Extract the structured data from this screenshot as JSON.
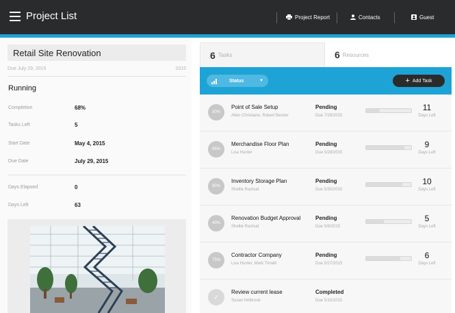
{
  "header": {
    "title": "Project List",
    "nav": [
      {
        "icon": "printer-icon",
        "label": "Project Report"
      },
      {
        "icon": "person-icon",
        "label": "Contacts"
      },
      {
        "icon": "user-icon",
        "label": "Guest"
      }
    ]
  },
  "project": {
    "title": "Retail Site Renovation",
    "due_text": "Due July 29, 2015",
    "year": "2015",
    "status": "Running",
    "stats": [
      {
        "label": "Completion",
        "value": "68%"
      },
      {
        "label": "Tasks Left",
        "value": "5"
      },
      {
        "label": "Start Date",
        "value": "May 4, 2015"
      },
      {
        "label": "Due Date",
        "value": "July 29, 2015"
      },
      {
        "label": "Days Elapsed",
        "value": "0"
      },
      {
        "label": "Days Left",
        "value": "63"
      }
    ]
  },
  "tabs": [
    {
      "count": "6",
      "label": "Tasks"
    },
    {
      "count": "6",
      "label": "Resources"
    }
  ],
  "toolbar": {
    "status_label": "Status",
    "add_task_label": "Add Task"
  },
  "colors": {
    "accent": "#1ea3d6",
    "header_bg": "#2a2b2d"
  },
  "tasks": [
    {
      "progress_label": "30%",
      "progress": 0.3,
      "name": "Point of Sale Setup",
      "people": "Allen Christiano, Robert Becker",
      "status": "Pending",
      "due": "Due 7/29/2015",
      "days": "11",
      "days_label": "Days Left"
    },
    {
      "progress_label": "85%",
      "progress": 0.85,
      "name": "Merchandise Floor Plan",
      "people": "Lisa Hunter",
      "status": "Pending",
      "due": "Due 5/28/2015",
      "days": "9",
      "days_label": "Days Left"
    },
    {
      "progress_label": "80%",
      "progress": 0.8,
      "name": "Inventory Storage Plan",
      "people": "Shellie Rashud",
      "status": "Pending",
      "due": "Due 5/30/2015",
      "days": "10",
      "days_label": "Days Left"
    },
    {
      "progress_label": "40%",
      "progress": 0.4,
      "name": "Renovation Budget Approval",
      "people": "Shellie Rashud",
      "status": "Pending",
      "due": "Due 5/8/2015",
      "days": "5",
      "days_label": "Days Left"
    },
    {
      "progress_label": "75%",
      "progress": 0.75,
      "name": "Contractor Company",
      "people": "Lisa Hunter, Mark Trinelli",
      "status": "Pending",
      "due": "Due 5/27/2015",
      "days": "6",
      "days_label": "Days Left"
    },
    {
      "progress_label": "✓",
      "progress": 1.0,
      "name": "Review current lease",
      "people": "Susan Holbrook",
      "status": "Completed",
      "due": "Due 5/15/2015",
      "days": "",
      "days_label": ""
    }
  ]
}
